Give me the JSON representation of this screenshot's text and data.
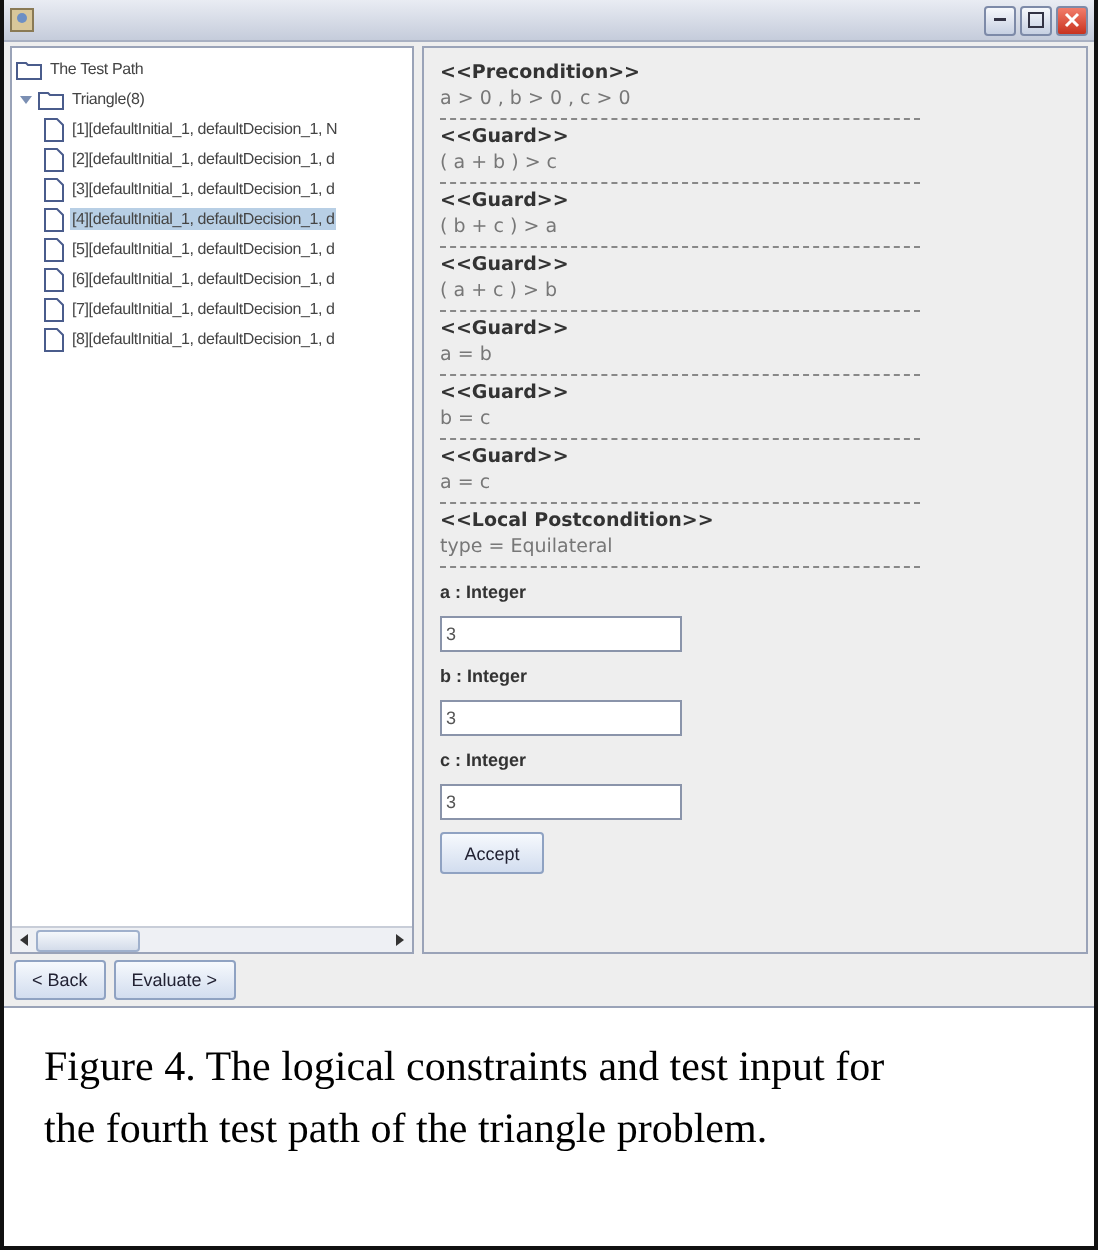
{
  "tree": {
    "root": {
      "label": "The Test Path",
      "children": [
        {
          "label": "Triangle(8)",
          "expanded": true,
          "children": [
            {
              "label": "[1][defaultInitial_1, defaultDecision_1, N",
              "selected": false
            },
            {
              "label": "[2][defaultInitial_1, defaultDecision_1, d",
              "selected": false
            },
            {
              "label": "[3][defaultInitial_1, defaultDecision_1, d",
              "selected": false
            },
            {
              "label": "[4][defaultInitial_1, defaultDecision_1, d",
              "selected": true
            },
            {
              "label": "[5][defaultInitial_1, defaultDecision_1, d",
              "selected": false
            },
            {
              "label": "[6][defaultInitial_1, defaultDecision_1, d",
              "selected": false
            },
            {
              "label": "[7][defaultInitial_1, defaultDecision_1, d",
              "selected": false
            },
            {
              "label": "[8][defaultInitial_1, defaultDecision_1, d",
              "selected": false
            }
          ]
        }
      ]
    }
  },
  "constraints": [
    {
      "heading": "<<Precondition>>",
      "expression": "a > 0 , b > 0 , c > 0"
    },
    {
      "heading": "<<Guard>>",
      "expression": "( a + b ) > c"
    },
    {
      "heading": "<<Guard>>",
      "expression": "( b + c ) > a"
    },
    {
      "heading": "<<Guard>>",
      "expression": "( a + c ) > b"
    },
    {
      "heading": "<<Guard>>",
      "expression": "a = b"
    },
    {
      "heading": "<<Guard>>",
      "expression": "b = c"
    },
    {
      "heading": "<<Guard>>",
      "expression": "a = c"
    },
    {
      "heading": "<<Local Postcondition>>",
      "expression": "type = Equilateral"
    }
  ],
  "inputs": [
    {
      "label": "a : Integer",
      "value": "3"
    },
    {
      "label": "b : Integer",
      "value": "3"
    },
    {
      "label": "c : Integer",
      "value": "3"
    }
  ],
  "accept_button": "Accept",
  "buttons": [
    "< Back",
    "Evaluate >"
  ],
  "caption": "Figure 4. The logical constraints and test input for the fourth test path of the triangle problem."
}
